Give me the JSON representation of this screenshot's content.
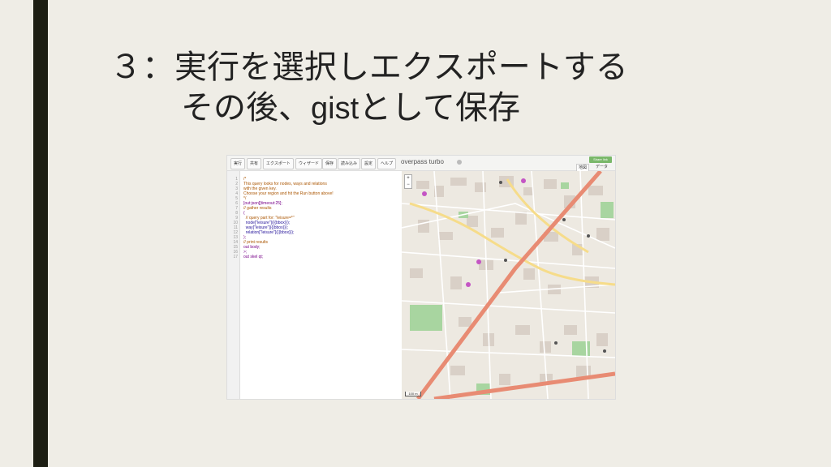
{
  "slide": {
    "title_line1": "３：実行を選択しエクスポートする",
    "title_line2_pre": "その後、",
    "title_line2_latin": "gist",
    "title_line2_post": "として保存"
  },
  "app": {
    "brand": "overpass turbo",
    "share_label": "Share link",
    "toolbar": [
      "実行",
      "共有",
      "エクスポート",
      "ウィザード",
      "保存",
      "読み込み",
      "設定",
      "ヘルプ"
    ],
    "tabs": [
      "地図",
      "データ"
    ],
    "zoom_in": "+",
    "zoom_out": "−",
    "scale_label": "100 m"
  },
  "editor": {
    "line_numbers": "1\n2\n3\n4\n5\n6\n7\n8\n9\n10\n11\n12\n13\n14\n15\n16\n17",
    "code": [
      {
        "cls": "c-com",
        "text": "/*"
      },
      {
        "cls": "c-com",
        "text": "This query looks for nodes, ways and relations"
      },
      {
        "cls": "c-com",
        "text": "with the given key."
      },
      {
        "cls": "c-com",
        "text": "Choose your region and hit the Run button above!"
      },
      {
        "cls": "c-com",
        "text": "*/"
      },
      {
        "cls": "c-kw",
        "text": "[out:json][timeout:25];"
      },
      {
        "cls": "c-com",
        "text": "// gather results"
      },
      {
        "cls": "c-kw",
        "text": "("
      },
      {
        "cls": "c-com",
        "text": "  // query part for: \"leisure=*\""
      },
      {
        "cls": "c-str",
        "text": "  node[\"leisure\"]({{bbox}});"
      },
      {
        "cls": "c-str",
        "text": "  way[\"leisure\"]({{bbox}});"
      },
      {
        "cls": "c-str",
        "text": "  relation[\"leisure\"]({{bbox}});"
      },
      {
        "cls": "c-kw",
        "text": ");"
      },
      {
        "cls": "c-com",
        "text": "// print results"
      },
      {
        "cls": "c-kw",
        "text": "out body;"
      },
      {
        "cls": "c-kw",
        "text": ">;"
      },
      {
        "cls": "c-kw",
        "text": "out skel qt;"
      }
    ]
  },
  "colors": {
    "road_main": "#e88b73",
    "road_secondary": "#f6dc8a",
    "park": "#a8d5a0",
    "building": "#d9d0c7",
    "background": "#ede9e1"
  }
}
